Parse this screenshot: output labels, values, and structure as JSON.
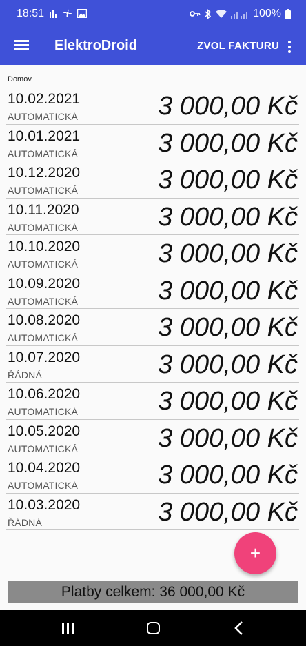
{
  "status_bar": {
    "time": "18:51",
    "battery": "100%"
  },
  "toolbar": {
    "title": "ElektroDroid",
    "action_label": "ZVOL FAKTURU"
  },
  "breadcrumb": "Domov",
  "invoices": [
    {
      "date": "10.02.2021",
      "type": "AUTOMATICKÁ",
      "amount": "3 000,00 Kč"
    },
    {
      "date": "10.01.2021",
      "type": "AUTOMATICKÁ",
      "amount": "3 000,00 Kč"
    },
    {
      "date": "10.12.2020",
      "type": "AUTOMATICKÁ",
      "amount": "3 000,00 Kč"
    },
    {
      "date": "10.11.2020",
      "type": "AUTOMATICKÁ",
      "amount": "3 000,00 Kč"
    },
    {
      "date": "10.10.2020",
      "type": "AUTOMATICKÁ",
      "amount": "3 000,00 Kč"
    },
    {
      "date": "10.09.2020",
      "type": "AUTOMATICKÁ",
      "amount": "3 000,00 Kč"
    },
    {
      "date": "10.08.2020",
      "type": "AUTOMATICKÁ",
      "amount": "3 000,00 Kč"
    },
    {
      "date": "10.07.2020",
      "type": "ŘÁDNÁ",
      "amount": "3 000,00 Kč"
    },
    {
      "date": "10.06.2020",
      "type": "AUTOMATICKÁ",
      "amount": "3 000,00 Kč"
    },
    {
      "date": "10.05.2020",
      "type": "AUTOMATICKÁ",
      "amount": "3 000,00 Kč"
    },
    {
      "date": "10.04.2020",
      "type": "AUTOMATICKÁ",
      "amount": "3 000,00 Kč"
    },
    {
      "date": "10.03.2020",
      "type": "ŘÁDNÁ",
      "amount": "3 000,00 Kč"
    }
  ],
  "fab": {
    "icon": "plus-icon",
    "label": "+"
  },
  "total": "Platby celkem: 36 000,00 Kč",
  "colors": {
    "app_bar": "#3f51d8",
    "fab": "#f0427a",
    "total_bar": "#8a8a8a"
  }
}
